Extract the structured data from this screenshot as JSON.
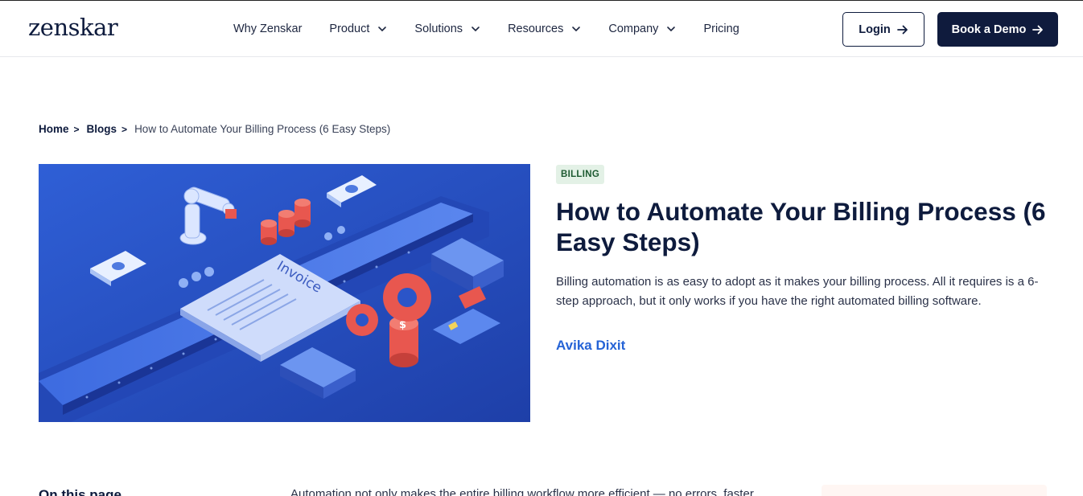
{
  "brand": {
    "logo_text": "zenskar"
  },
  "nav": {
    "items": [
      {
        "label": "Why Zenskar",
        "has_dropdown": false
      },
      {
        "label": "Product",
        "has_dropdown": true
      },
      {
        "label": "Solutions",
        "has_dropdown": true
      },
      {
        "label": "Resources",
        "has_dropdown": true
      },
      {
        "label": "Company",
        "has_dropdown": true
      },
      {
        "label": "Pricing",
        "has_dropdown": false
      }
    ],
    "login_label": "Login",
    "demo_label": "Book a Demo"
  },
  "breadcrumb": {
    "home": "Home",
    "blogs": "Blogs",
    "separator": ">",
    "current": "How to Automate Your Billing Process (6 Easy Steps)"
  },
  "hero": {
    "invoice_text": "Invoice",
    "coin_symbol": "$"
  },
  "article": {
    "tag": "BILLING",
    "title": "How to Automate Your Billing Process (6 Easy Steps)",
    "description": "Billing automation is as easy to adopt as it makes your billing process. All it requires is a 6-step approach, but it only works if you have the right automated billing software.",
    "author": "Avika Dixit"
  },
  "below_fold": {
    "toc_title": "On this page",
    "intro_text": "Automation not only makes the entire billing workflow more efficient — no errors, faster"
  },
  "colors": {
    "navy": "#0f1b3d",
    "accent_blue": "#2563d6",
    "tag_bg": "#e3f1e6",
    "tag_text": "#1d5a31",
    "hero_bg": "#2b55c8",
    "coin_red": "#e8574f"
  }
}
